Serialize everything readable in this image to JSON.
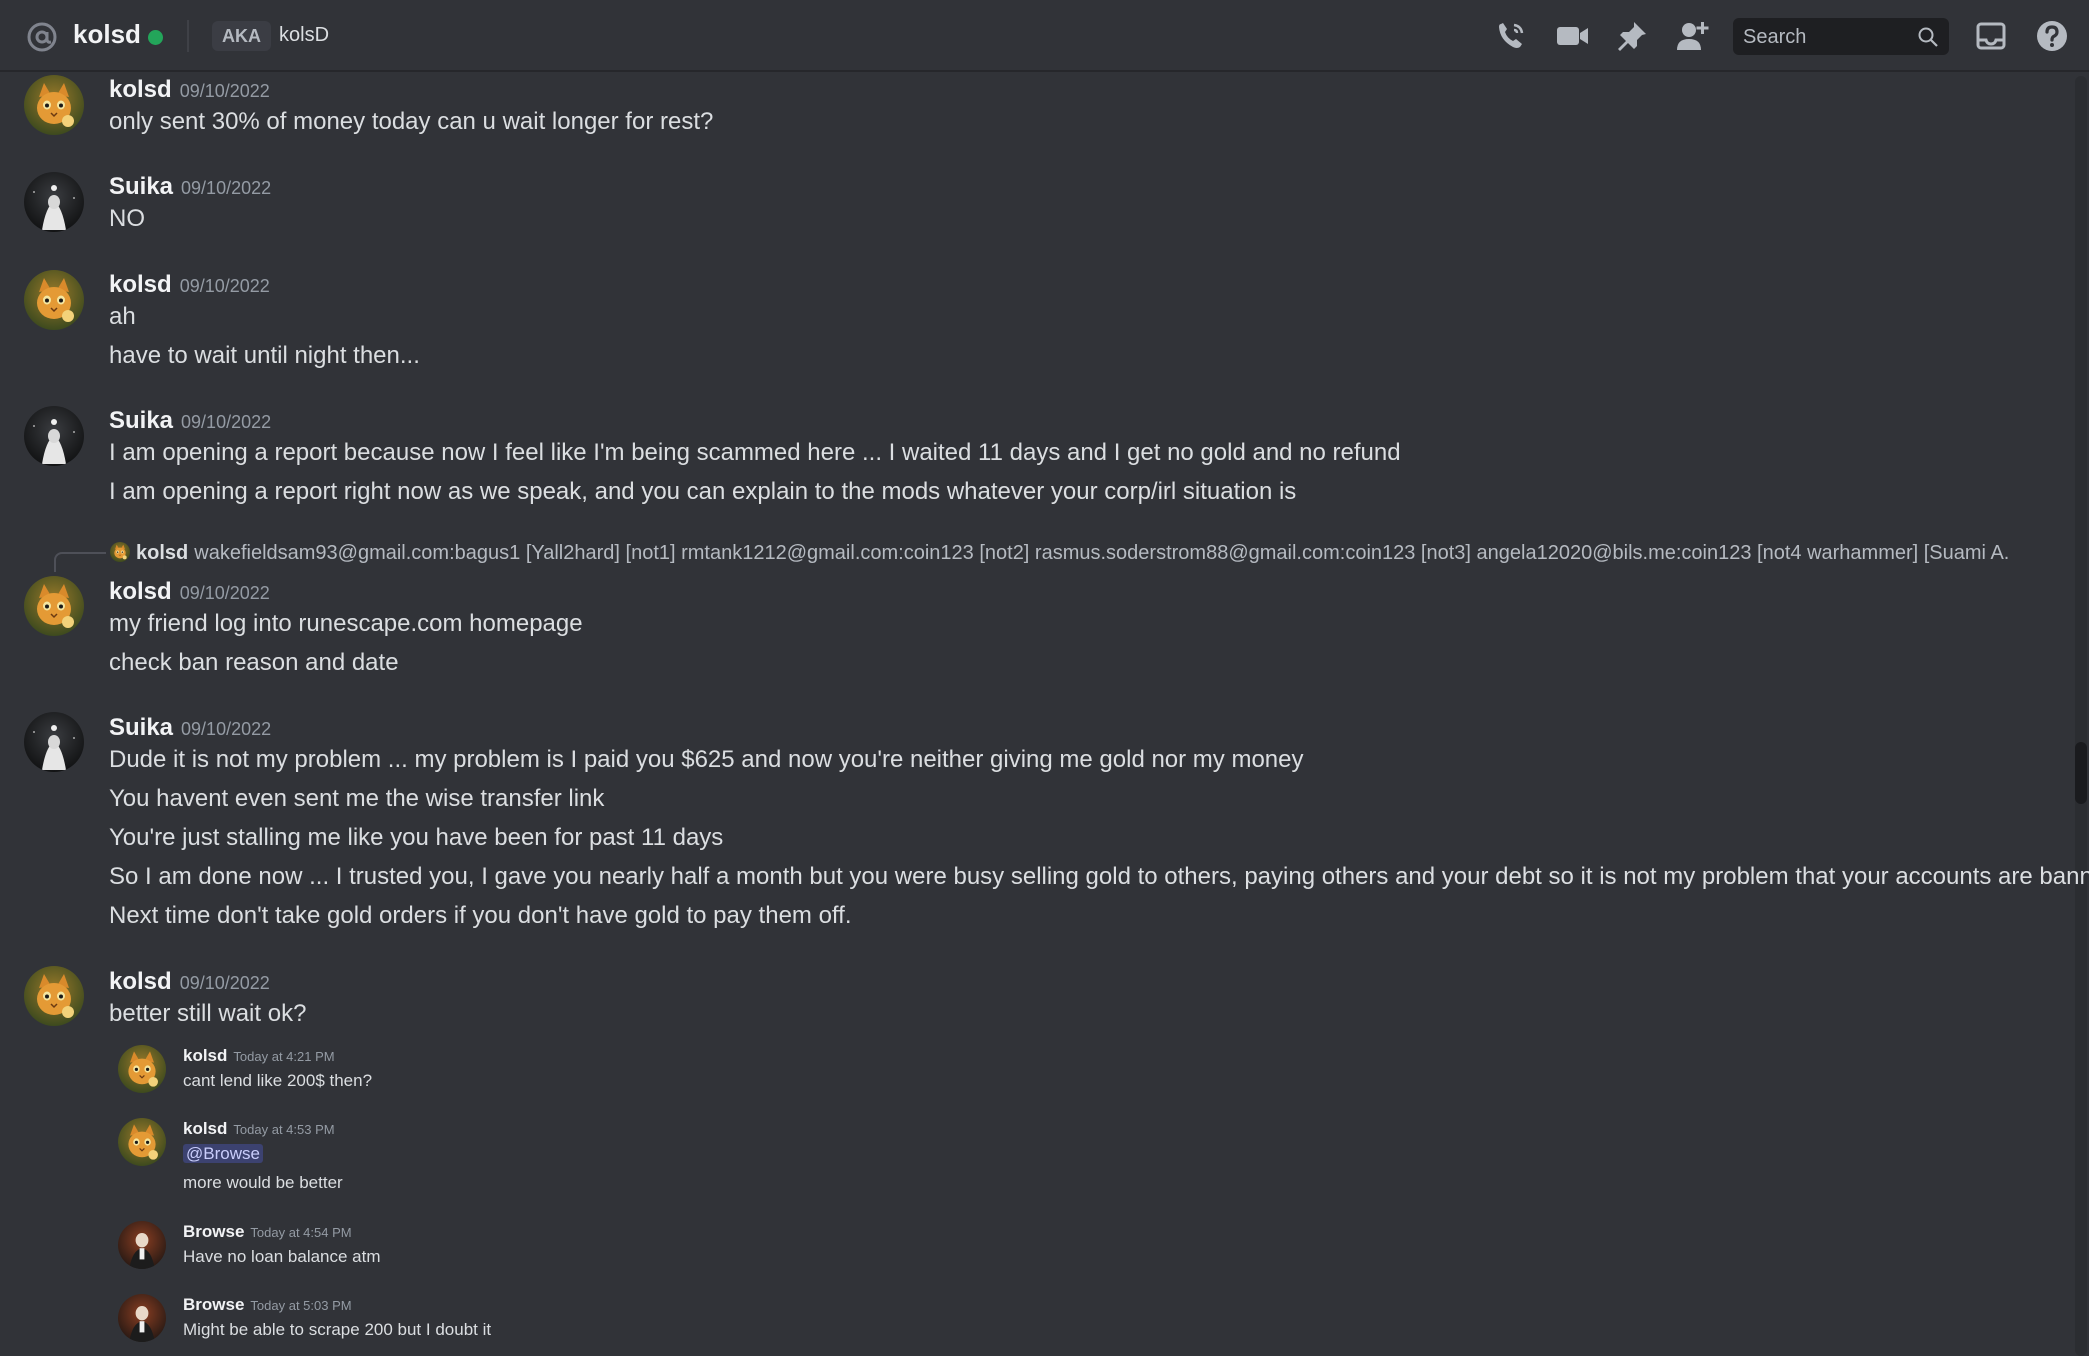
{
  "header": {
    "dm_name": "kolsd",
    "aka_label": "AKA",
    "aka_name": "kolsD",
    "search_placeholder": "Search",
    "icons": [
      "at-icon",
      "call-icon",
      "video-icon",
      "pin-icon",
      "add-friend-icon",
      "search-icon",
      "inbox-icon",
      "help-icon"
    ]
  },
  "messages": [
    {
      "user": "kolsd",
      "date": "09/10/2022",
      "lines": [
        "only sent 30% of money today can u wait longer for rest?"
      ]
    },
    {
      "user": "Suika",
      "date": "09/10/2022",
      "lines": [
        "NO"
      ]
    },
    {
      "user": "kolsd",
      "date": "09/10/2022",
      "lines": [
        "ah",
        "have to wait until night then..."
      ]
    },
    {
      "user": "Suika",
      "date": "09/10/2022",
      "lines": [
        "I am opening a report because now I feel like I'm being scammed here ... I waited 11 days and I get no gold and no refund",
        "I am opening a report right now as we speak, and you can explain to the mods whatever your corp/irl situation is"
      ]
    },
    {
      "user": "kolsd",
      "date": "09/10/2022",
      "lines": [
        "my friend log into runescape.com homepage",
        "check ban reason and date"
      ]
    },
    {
      "user": "Suika",
      "date": "09/10/2022",
      "lines": [
        "Dude it is not my problem ... my problem is I paid you $625 and now you're neither giving me gold nor my money",
        "You havent even sent me the wise transfer link",
        "You're just stalling me like you have been for past 11 days",
        "So I am done now ... I trusted you, I gave you nearly half a month but you were busy selling gold to others, paying others and your debt so it is not my problem that your accounts are banned.",
        "Next time don't take gold orders if you don't have gold to pay them off."
      ]
    },
    {
      "user": "kolsd",
      "date": "09/10/2022",
      "lines": [
        "better still wait ok?"
      ]
    }
  ],
  "reply": {
    "user": "kolsd",
    "text": "wakefieldsam93@gmail.com:bagus1 [Yall2hard] [not1] rmtank1212@gmail.com:coin123 [not2] rasmus.soderstrom88@gmail.com:coin123 [not3]  angela12020@bils.me:coin123 [not4 warhammer] [Suami A..."
  },
  "embedded": [
    {
      "user": "kolsd",
      "time": "Today at 4:21 PM",
      "lines": [
        "cant lend like 200$ then?"
      ]
    },
    {
      "user": "kolsd",
      "time": "Today at 4:53 PM",
      "mention": "@Browse",
      "lines": [
        "more would be better"
      ]
    },
    {
      "user": "Browse",
      "time": "Today at 4:54 PM",
      "lines": [
        "Have no loan balance atm"
      ]
    },
    {
      "user": "Browse",
      "time": "Today at 5:03 PM",
      "lines": [
        "Might be able to scrape 200 but I doubt it"
      ]
    }
  ],
  "colors": {
    "background": "#313338",
    "online": "#23a55a",
    "mention_bg": "#3c4270"
  }
}
